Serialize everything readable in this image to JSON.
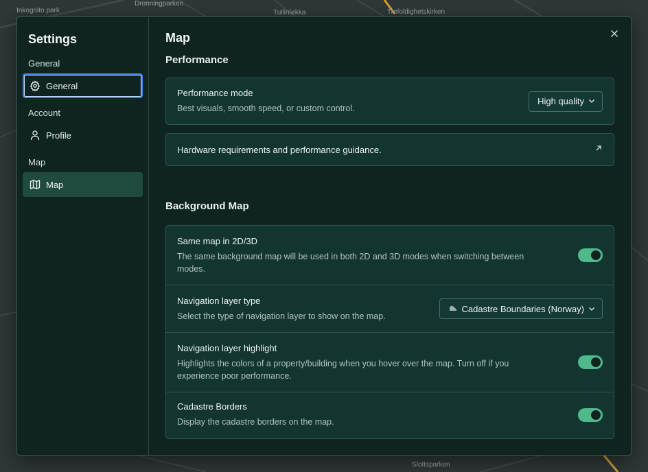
{
  "map_labels": [
    "Inkognito park",
    "Dronningparken",
    "Tullinløkka",
    "Trefoldighetskirken",
    "Slottsparken"
  ],
  "sidebar": {
    "title": "Settings",
    "sections": [
      {
        "label": "General",
        "item": {
          "label": "General",
          "icon": "gear-icon"
        }
      },
      {
        "label": "Account",
        "item": {
          "label": "Profile",
          "icon": "user-icon"
        }
      },
      {
        "label": "Map",
        "item": {
          "label": "Map",
          "icon": "map-icon"
        }
      }
    ]
  },
  "main": {
    "title": "Map",
    "performance": {
      "heading": "Performance",
      "mode_title": "Performance mode",
      "mode_desc": "Best visuals, smooth speed, or custom control.",
      "mode_value": "High quality",
      "guidance_link": "Hardware requirements and performance guidance."
    },
    "background": {
      "heading": "Background Map",
      "rows": [
        {
          "title": "Same map in 2D/3D",
          "desc": "The same background map will be used in both 2D and 3D modes when switching between modes.",
          "enabled": true
        },
        {
          "title": "Navigation layer type",
          "desc": "Select the type of navigation layer to show on the map.",
          "value": "Cadastre Boundaries (Norway)"
        },
        {
          "title": "Navigation layer highlight",
          "desc": "Highlights the colors of a property/building when you hover over the map. Turn off if you experience poor performance.",
          "enabled": true
        },
        {
          "title": "Cadastre Borders",
          "desc": "Display the cadastre borders on the map.",
          "enabled": true
        }
      ]
    }
  },
  "colors": {
    "accent_toggle": "#4fb98c",
    "dialog_bg": "#0f2420",
    "card_bg": "#133530",
    "focus_ring": "#3b82f6"
  }
}
